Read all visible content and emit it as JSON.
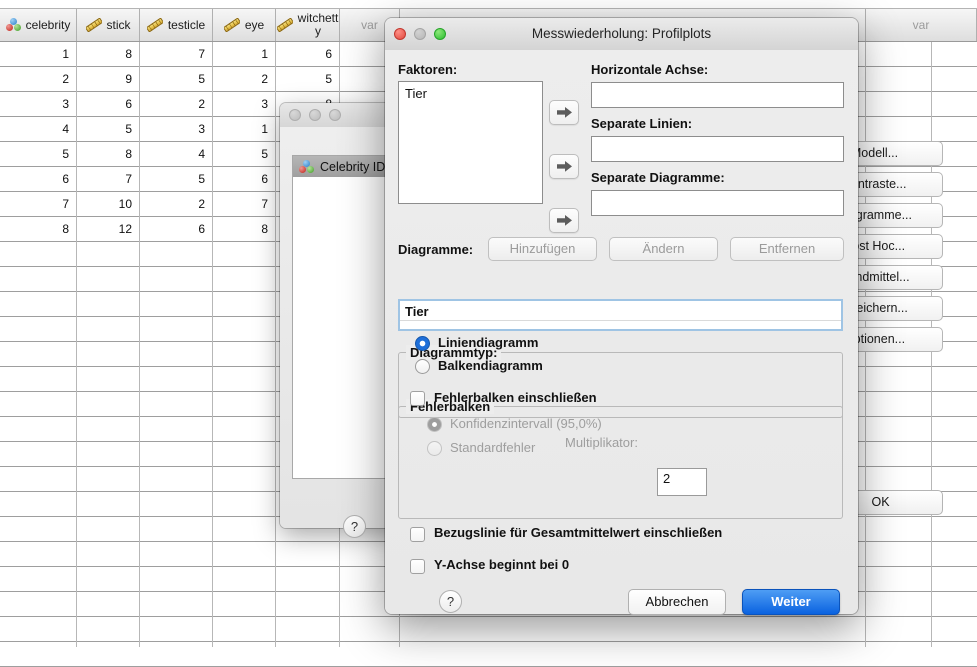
{
  "spreadsheet": {
    "columns": [
      {
        "name": "celebrity",
        "icon": "nominal-icon",
        "measure": "nominal"
      },
      {
        "name": "stick",
        "icon": "scale-ruler-icon",
        "measure": "scale"
      },
      {
        "name": "testicle",
        "icon": "scale-ruler-icon",
        "measure": "scale"
      },
      {
        "name": "eye",
        "icon": "scale-ruler-icon",
        "measure": "scale"
      },
      {
        "name": "witchetty",
        "icon": "scale-ruler-icon",
        "measure": "scale"
      },
      {
        "name": "var",
        "icon": "",
        "measure": "empty"
      },
      {
        "name": "var",
        "icon": "",
        "measure": "empty"
      },
      {
        "name": "var",
        "icon": "",
        "measure": "empty"
      }
    ],
    "rows": [
      {
        "num": "1",
        "celebrity": "1",
        "stick": "8",
        "testicle": "7",
        "eye": "1",
        "witchetty": "6"
      },
      {
        "num": "2",
        "celebrity": "2",
        "stick": "9",
        "testicle": "5",
        "eye": "2",
        "witchetty": "5"
      },
      {
        "num": "3",
        "celebrity": "3",
        "stick": "6",
        "testicle": "2",
        "eye": "3",
        "witchetty": "8"
      },
      {
        "num": "4",
        "celebrity": "4",
        "stick": "5",
        "testicle": "3",
        "eye": "1",
        "witchetty": ""
      },
      {
        "num": "5",
        "celebrity": "5",
        "stick": "8",
        "testicle": "4",
        "eye": "5",
        "witchetty": ""
      },
      {
        "num": "6",
        "celebrity": "6",
        "stick": "7",
        "testicle": "5",
        "eye": "6",
        "witchetty": ""
      },
      {
        "num": "7",
        "celebrity": "7",
        "stick": "10",
        "testicle": "2",
        "eye": "7",
        "witchetty": ""
      },
      {
        "num": "8",
        "celebrity": "8",
        "stick": "12",
        "testicle": "6",
        "eye": "8",
        "witchetty": ""
      }
    ]
  },
  "background_window": {
    "side_buttons": [
      {
        "label": "Modell...",
        "visible_text": "ell..."
      },
      {
        "label": "Kontraste...",
        "visible_text": "ste..."
      },
      {
        "label": "Diagramme...",
        "visible_text": "mme..."
      },
      {
        "label": "Post Hoc...",
        "visible_text": "oc..."
      },
      {
        "label": "Randmittel...",
        "visible_text": "andmittel..."
      },
      {
        "label": "Speichern...",
        "visible_text": "ern..."
      },
      {
        "label": "Optionen...",
        "visible_text": "nen..."
      }
    ],
    "ok_label": "OK"
  },
  "small_window": {
    "list_items": [
      {
        "label": "Celebrity ID",
        "icon": "nominal-icon"
      }
    ],
    "help_label": "?"
  },
  "dialog": {
    "title": "Messwiederholung: Profilplots",
    "traffic_lights": {
      "close": "close-button",
      "minimize": "minimize-button",
      "zoom": "zoom-button"
    },
    "factors": {
      "label": "Faktoren:",
      "items": [
        "Tier"
      ]
    },
    "targets": [
      {
        "label": "Horizontale Achse:",
        "value": "",
        "arrow": "move-right-arrow-icon"
      },
      {
        "label": "Separate Linien:",
        "value": "",
        "arrow": "move-right-arrow-icon"
      },
      {
        "label": "Separate Diagramme:",
        "value": "",
        "arrow": "move-right-arrow-icon"
      }
    ],
    "charts": {
      "label": "Diagramme:",
      "buttons": [
        {
          "label": "Hinzufügen",
          "enabled": false
        },
        {
          "label": "Ändern",
          "enabled": false
        },
        {
          "label": "Entfernen",
          "enabled": false
        }
      ],
      "list": [
        "Tier"
      ]
    },
    "chart_type": {
      "legend": "Diagrammtyp:",
      "options": [
        {
          "label": "Liniendiagramm",
          "selected": true,
          "enabled": true
        },
        {
          "label": "Balkendiagramm",
          "selected": false,
          "enabled": true
        }
      ]
    },
    "error_bars": {
      "legend": "Fehlerbalken",
      "include": {
        "label": "Fehlerbalken einschließen",
        "checked": false
      },
      "options": [
        {
          "label": "Konfidenzintervall (95,0%)",
          "selected": true,
          "enabled": false
        },
        {
          "label": "Standardfehler",
          "selected": false,
          "enabled": false
        }
      ],
      "multiplier": {
        "label": "Multiplikator:",
        "value": "2",
        "enabled": false
      }
    },
    "extra_options": [
      {
        "label": "Bezugslinie für Gesamtmittelwert einschließen",
        "checked": false
      },
      {
        "label": "Y-Achse beginnt bei 0",
        "checked": false
      }
    ],
    "footer": {
      "help": "?",
      "cancel": "Abbrechen",
      "continue": "Weiter"
    }
  },
  "colors": {
    "accent_blue": "#0a62e0",
    "selection_border": "#9fc4e4",
    "radio_on": "#1e6fd9",
    "disabled_text": "#9e9e9e",
    "window_bg": "#ececec"
  }
}
